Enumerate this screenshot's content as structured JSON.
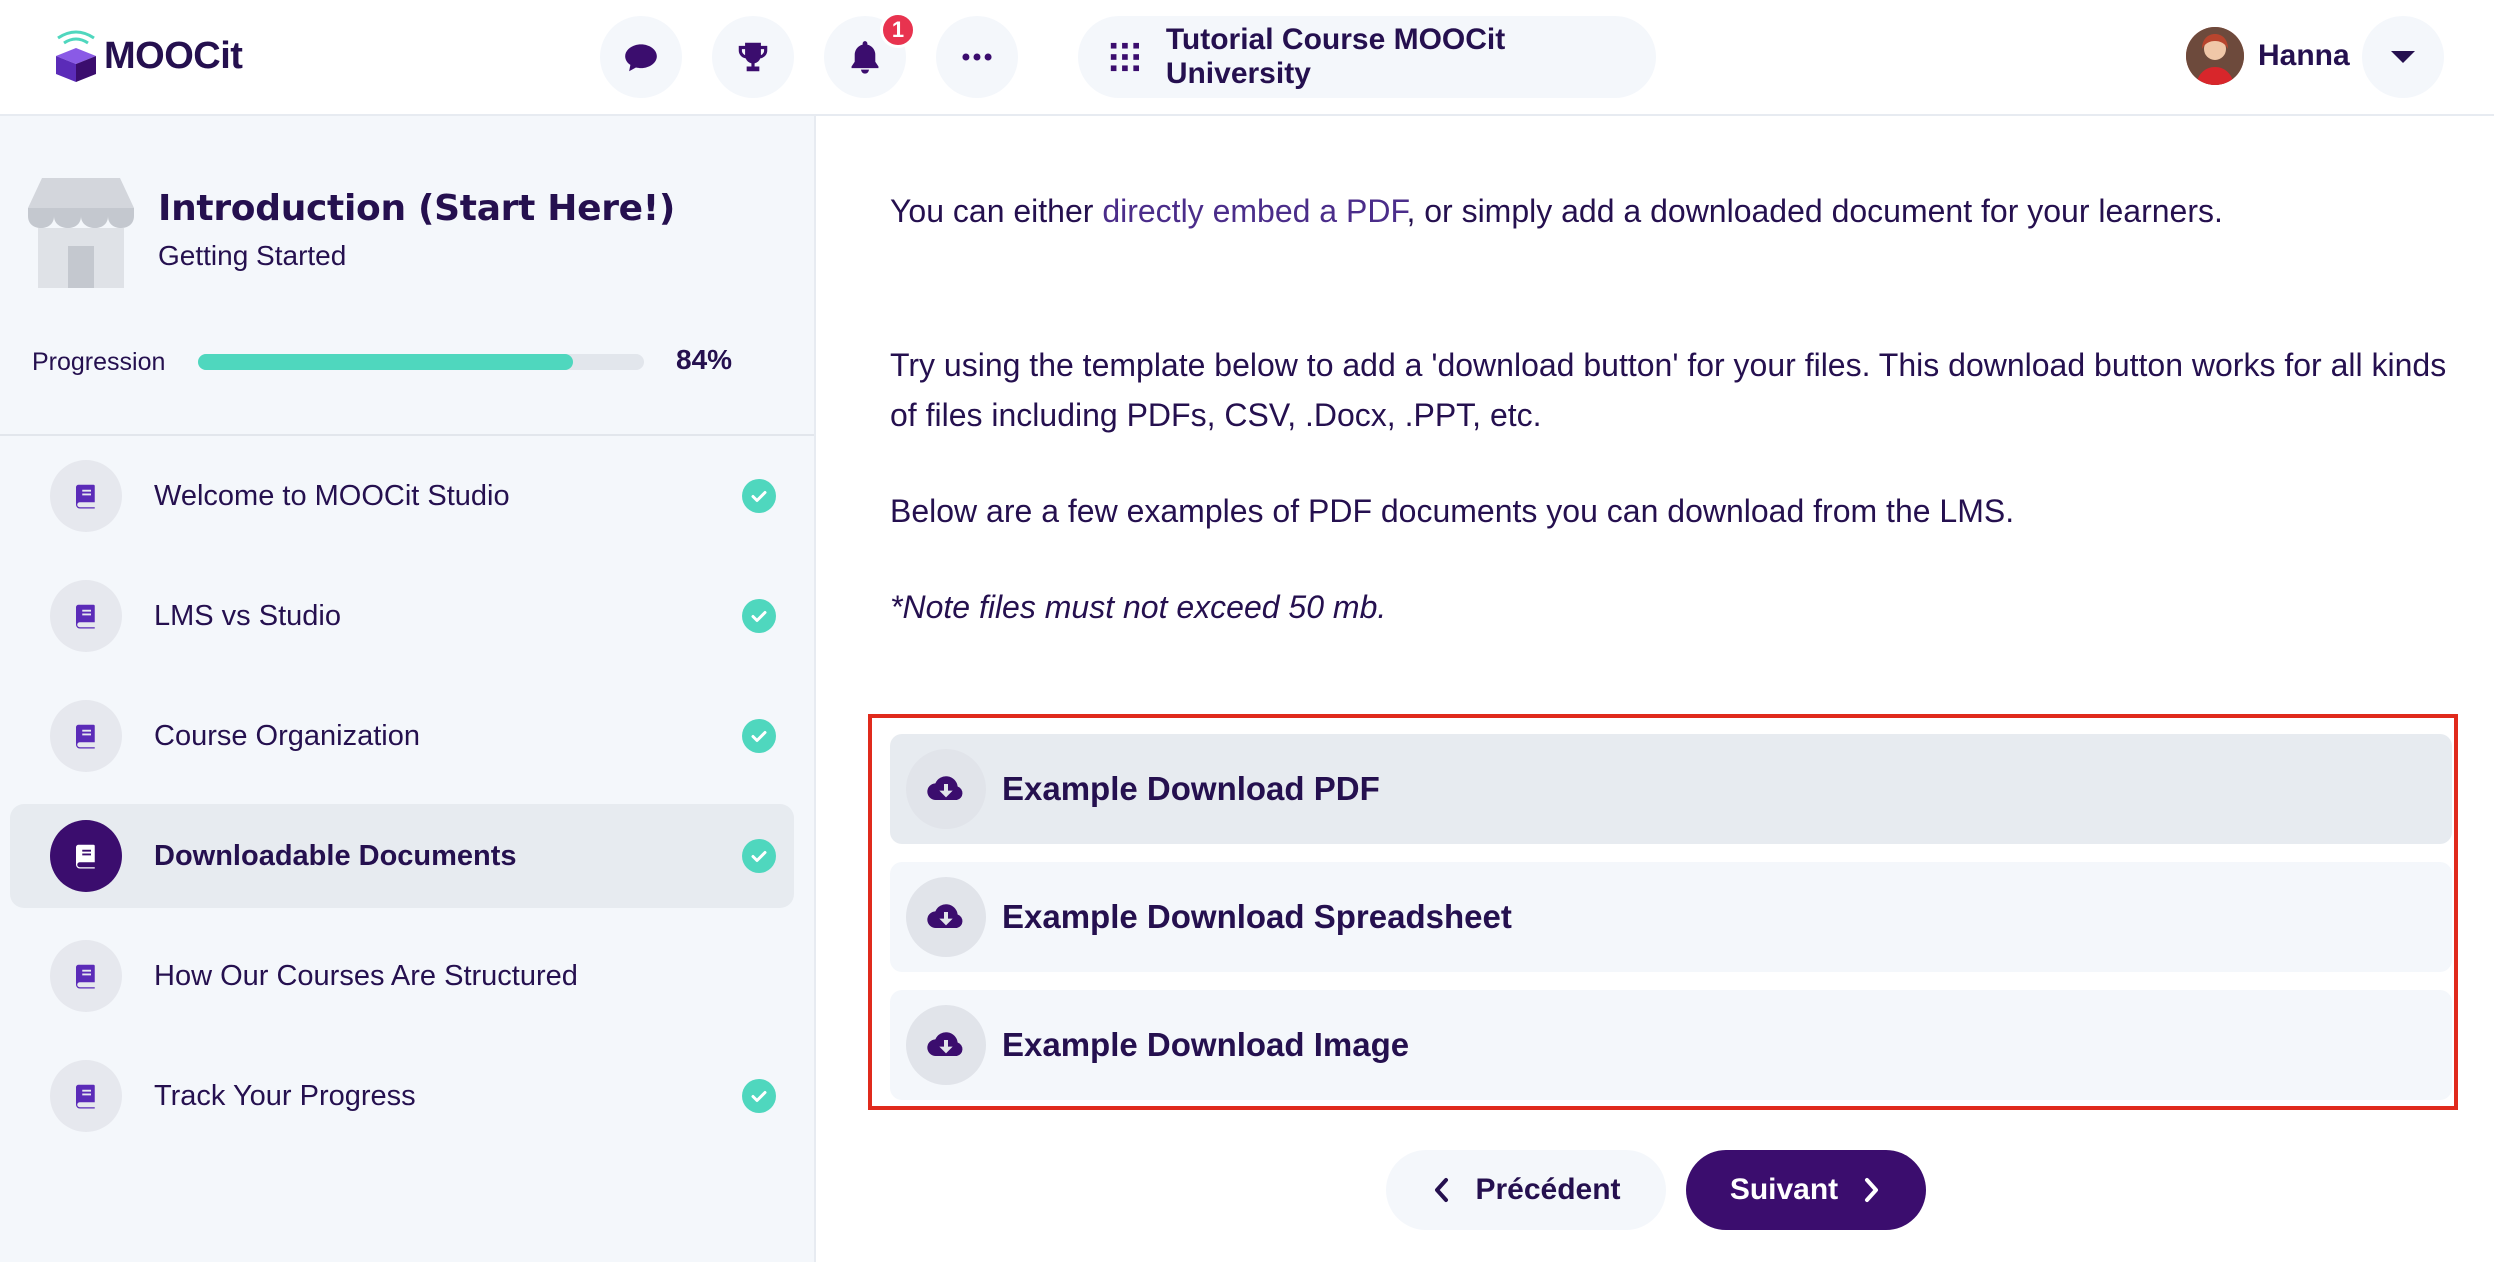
{
  "header": {
    "logo_text": "MOOCit",
    "icons": [
      "chat-icon",
      "trophy-icon",
      "bell-icon",
      "more-icon"
    ],
    "notification_count": "1",
    "course_title": "Tutorial Course MOOCit University",
    "user_name": "Hanna"
  },
  "sidebar": {
    "section_title": "Introduction (Start Here!)",
    "section_subtitle": "Getting Started",
    "progress_label": "Progression",
    "progress_value": "84%",
    "progress_fraction": 0.84,
    "lessons": [
      {
        "label": "Welcome to MOOCit Studio",
        "completed": true,
        "active": false
      },
      {
        "label": "LMS vs Studio",
        "completed": true,
        "active": false
      },
      {
        "label": "Course Organization",
        "completed": true,
        "active": false
      },
      {
        "label": "Downloadable Documents",
        "completed": true,
        "active": true
      },
      {
        "label": "How Our Courses Are Structured",
        "completed": false,
        "active": false
      },
      {
        "label": "Track Your Progress",
        "completed": true,
        "active": false
      }
    ]
  },
  "main": {
    "intro_before_link": "You can either ",
    "intro_link": "directly embed a PDF",
    "intro_after_link": ", or simply add a downloaded document for your learners.",
    "template_text": "Try using the template below to add a 'download button' for your files. This download button works for all kinds of files including PDFs, CSV, .Docx, .PPT, etc.",
    "examples_text": "Below are a few examples of PDF documents you can download from the LMS.",
    "note_text": "*Note files must not exceed 50 mb.",
    "downloads": [
      {
        "label": "Example Download PDF"
      },
      {
        "label": "Example Download Spreadsheet"
      },
      {
        "label": "Example Download Image"
      }
    ],
    "prev_label": "Précédent",
    "next_label": "Suivant"
  },
  "colors": {
    "primary": "#3b0d6e",
    "text": "#25104f",
    "accent_teal": "#4fd7be",
    "badge_red": "#e8334f",
    "highlight_red": "#e02a1c",
    "panel_bg": "#f4f7fb"
  }
}
